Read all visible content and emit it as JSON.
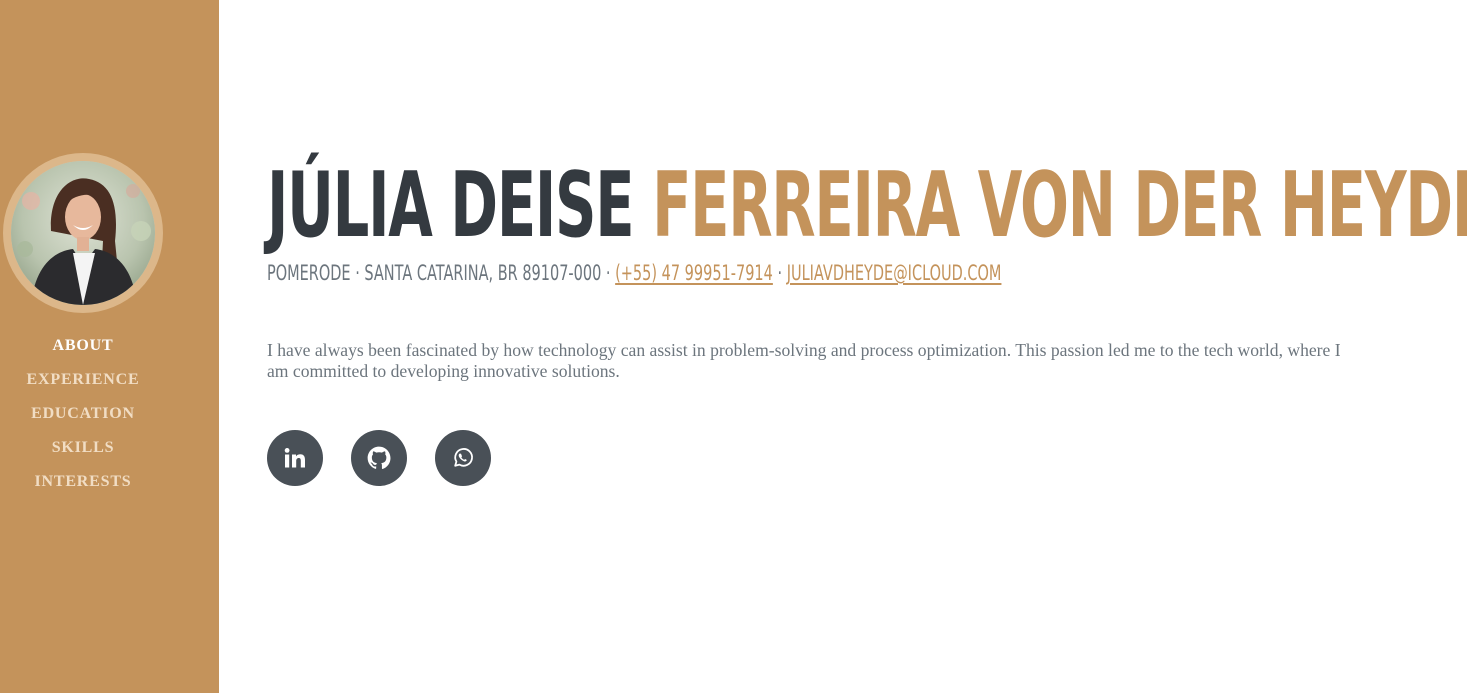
{
  "profile": {
    "first_name": "JÚLIA DEISE",
    "last_name": "FERREIRA VON DER HEYDE",
    "address": "POMERODE · SANTA CATARINA, BR 89107-000 ·",
    "separator": " · ",
    "phone": "(+55) 47 99951-7914",
    "email": "JULIAVDHEYDE@ICLOUD.COM",
    "bio": "I have always been fascinated by how technology can assist in problem-solving and process optimization. This passion led me to the tech world, where I am committed to developing innovative solutions."
  },
  "nav": {
    "items": [
      "ABOUT",
      "EXPERIENCE",
      "EDUCATION",
      "SKILLS",
      "INTERESTS"
    ],
    "active": "ABOUT"
  },
  "socials": [
    {
      "name": "linkedin",
      "icon": "linkedin-icon"
    },
    {
      "name": "github",
      "icon": "github-icon"
    },
    {
      "name": "whatsapp",
      "icon": "whatsapp-icon"
    }
  ],
  "colors": {
    "primary": "#c4935b",
    "heading": "#343a40",
    "muted": "#6c757d",
    "social_bg": "#495057",
    "nav_inactive": "#f1ddc4",
    "nav_active": "#ffffff"
  }
}
